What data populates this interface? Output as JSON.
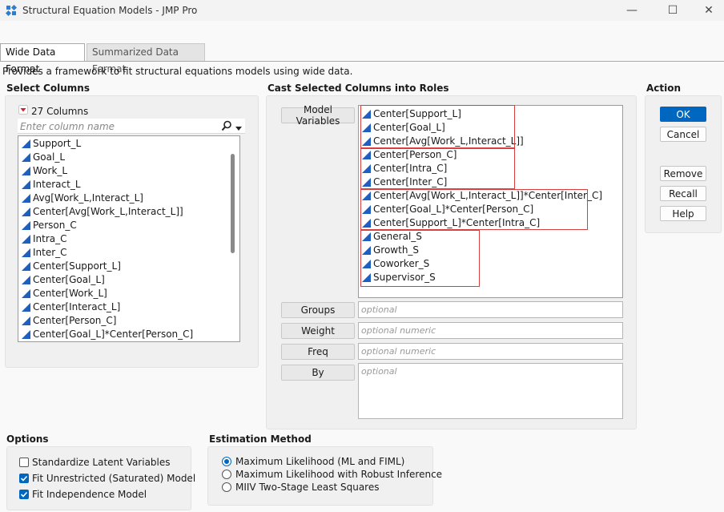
{
  "window": {
    "title": "Structural Equation Models - JMP Pro",
    "minimize": "—",
    "maximize": "☐",
    "close": "✕"
  },
  "tabs": [
    {
      "label": "Wide Data Format",
      "active": true
    },
    {
      "label": "Summarized Data Format",
      "active": false
    }
  ],
  "description": "Provides a framework to fit structural equations models using wide data.",
  "select_columns": {
    "title": "Select Columns",
    "count_label": "27 Columns",
    "search_placeholder": "Enter column name",
    "items": [
      "Support_L",
      "Goal_L",
      "Work_L",
      "Interact_L",
      "Avg[Work_L,Interact_L]",
      "Center[Avg[Work_L,Interact_L]]",
      "Person_C",
      "Intra_C",
      "Inter_C",
      "Center[Support_L]",
      "Center[Goal_L]",
      "Center[Work_L]",
      "Center[Interact_L]",
      "Center[Person_C]",
      "Center[Goal_L]*Center[Person_C]"
    ]
  },
  "cast": {
    "title": "Cast Selected Columns into Roles",
    "model_variables_label": "Model Variables",
    "model_variables": [
      "Center[Support_L]",
      "Center[Goal_L]",
      "Center[Avg[Work_L,Interact_L]]",
      "Center[Person_C]",
      "Center[Intra_C]",
      "Center[Inter_C]",
      "Center[Avg[Work_L,Interact_L]]*Center[Inter_C]",
      "Center[Goal_L]*Center[Person_C]",
      "Center[Support_L]*Center[Intra_C]",
      "General_S",
      "Growth_S",
      "Coworker_S",
      "Supervisor_S"
    ],
    "groups_label": "Groups",
    "groups_placeholder": "optional",
    "weight_label": "Weight",
    "weight_placeholder": "optional numeric",
    "freq_label": "Freq",
    "freq_placeholder": "optional numeric",
    "by_label": "By",
    "by_placeholder": "optional"
  },
  "action": {
    "title": "Action",
    "ok": "OK",
    "cancel": "Cancel",
    "remove": "Remove",
    "recall": "Recall",
    "help": "Help"
  },
  "options": {
    "title": "Options",
    "items": [
      {
        "label": "Standardize Latent Variables",
        "checked": false
      },
      {
        "label": "Fit Unrestricted (Saturated) Model",
        "checked": true
      },
      {
        "label": "Fit Independence Model",
        "checked": true
      }
    ]
  },
  "estimation": {
    "title": "Estimation Method",
    "items": [
      {
        "label": "Maximum Likelihood (ML and FIML)",
        "selected": true
      },
      {
        "label": "Maximum Likelihood with Robust Inference",
        "selected": false
      },
      {
        "label": "MIIV Two-Stage Least Squares",
        "selected": false
      }
    ]
  },
  "colors": {
    "accent": "#0067c0",
    "highlight_box": "#d84040",
    "continuous_icon": "#1f5fbf",
    "column_menu_icon": "#cc2233"
  },
  "icons": {
    "app": "jmp-app-icon",
    "column_type": "continuous-triangle-icon",
    "search": "search-icon",
    "dropdown": "chevron-down-icon",
    "columns_menu": "red-triangle-menu-icon"
  }
}
